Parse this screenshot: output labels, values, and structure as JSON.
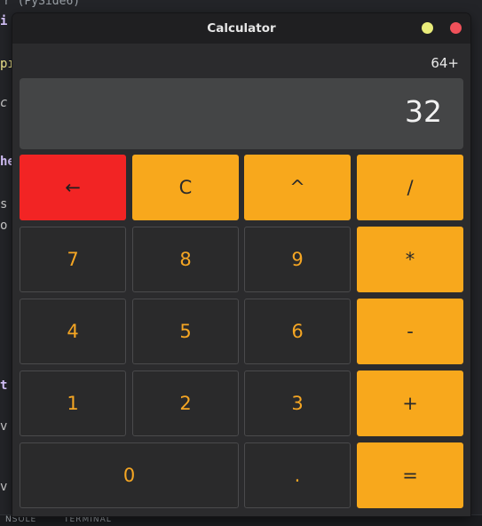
{
  "background_editor": {
    "top_fragment": "r (PySide6)",
    "side_fragments": [
      "i",
      "pı",
      "c",
      "he",
      "s",
      "o",
      "t",
      "v",
      "v"
    ],
    "bottom_fragments": [
      "NSOLE",
      "TERMINAL"
    ]
  },
  "window": {
    "title": "Calculator"
  },
  "display": {
    "expression": "64+",
    "value": "32"
  },
  "keypad": {
    "backspace": "←",
    "clear": "C",
    "power": "^",
    "divide": "/",
    "seven": "7",
    "eight": "8",
    "nine": "9",
    "multiply": "*",
    "four": "4",
    "five": "5",
    "six": "6",
    "subtract": "-",
    "one": "1",
    "two": "2",
    "three": "3",
    "add": "+",
    "zero": "0",
    "decimal": ".",
    "equals": "="
  },
  "colors": {
    "operator_accent": "#f8a81c",
    "backspace_accent": "#f22424",
    "digit_text": "#f5a623",
    "window_bg": "#2b2b2d",
    "display_bg": "#444546"
  }
}
